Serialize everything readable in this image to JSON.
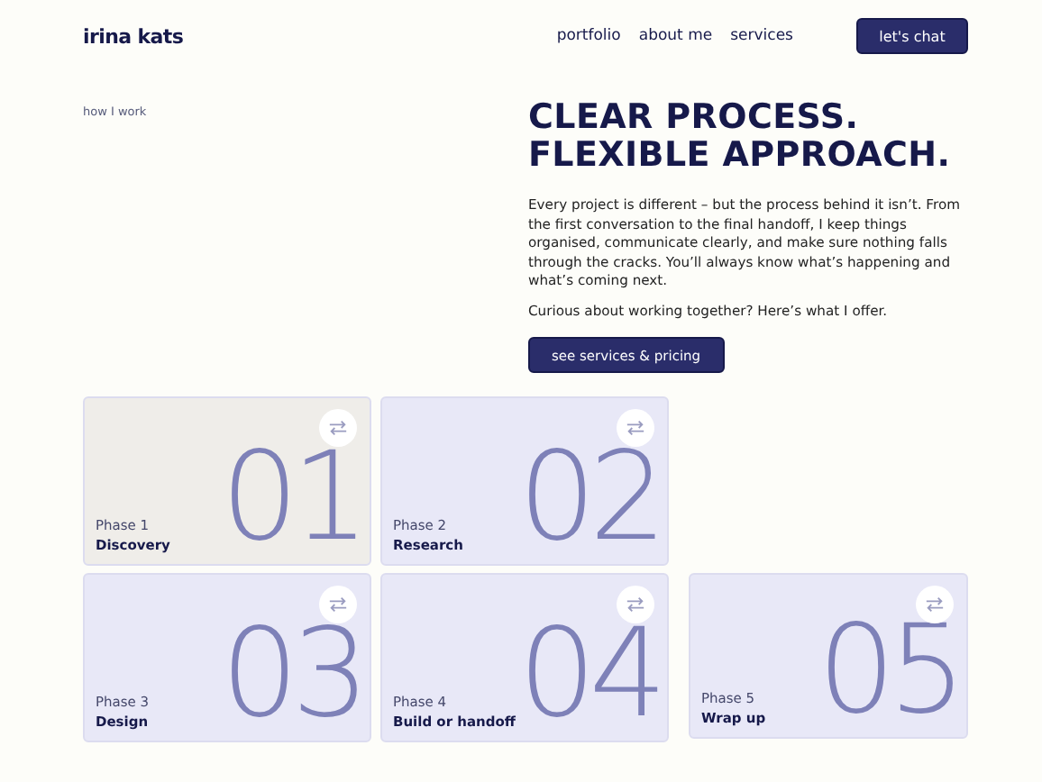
{
  "header": {
    "logo": "irina kats",
    "nav": [
      "portfolio",
      "about me",
      "services"
    ],
    "cta": "let's chat"
  },
  "section_label": "how I work",
  "title_lines": [
    "CLEAR PROCESS.",
    "FLEXIBLE APPROACH."
  ],
  "paragraphs": [
    "Every project is different – but the process behind it isn’t. From the first conversation to the final handoff, I keep things organised, communicate clearly, and make sure nothing falls through the cracks. You’ll always know what’s happening and what’s coming next.",
    "Curious about working together? Here’s what I offer."
  ],
  "button": "see services & pricing",
  "phases": [
    {
      "phase": "Phase 1",
      "name": "Discovery",
      "number": "01",
      "color": "#efede9"
    },
    {
      "phase": "Phase 2",
      "name": "Research",
      "number": "02",
      "color": "#e8e8f7"
    },
    {
      "phase": "Phase 3",
      "name": "Design",
      "number": "03",
      "color": "#e8e8f7"
    },
    {
      "phase": "Phase 4",
      "name": "Build or handoff",
      "number": "04",
      "color": "#e8e8f7"
    },
    {
      "phase": "Phase 5",
      "name": "Wrap up",
      "number": "05",
      "color": "#e8e8f7"
    }
  ]
}
